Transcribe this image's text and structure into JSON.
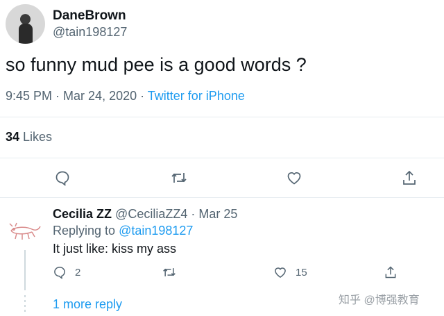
{
  "tweet": {
    "author_name": "DaneBrown",
    "author_handle": "@tain198127",
    "text": "so funny mud pee is a good words ?",
    "time": "9:45 PM",
    "separator1": " · ",
    "date": "Mar 24, 2020",
    "separator2": " · ",
    "source": "Twitter for iPhone",
    "likes_count": "34",
    "likes_label": " Likes",
    "actions": [
      "reply-icon",
      "retweet-icon",
      "like-icon",
      "share-icon"
    ]
  },
  "reply": {
    "author_name": "Cecilia ZZ",
    "author_handle": "@CeciliaZZ4",
    "date_sep": " · ",
    "date": "Mar 25",
    "replying_label": "Replying to ",
    "replying_to": "@tain198127",
    "text": "It just like: kiss my ass",
    "reply_count": "2",
    "like_count": "15",
    "more_replies": "1 more reply"
  },
  "watermark": "知乎 @博强教育",
  "colors": {
    "accent": "#1d9bf0",
    "secondary_text": "#536471",
    "primary_text": "#0f1419"
  }
}
